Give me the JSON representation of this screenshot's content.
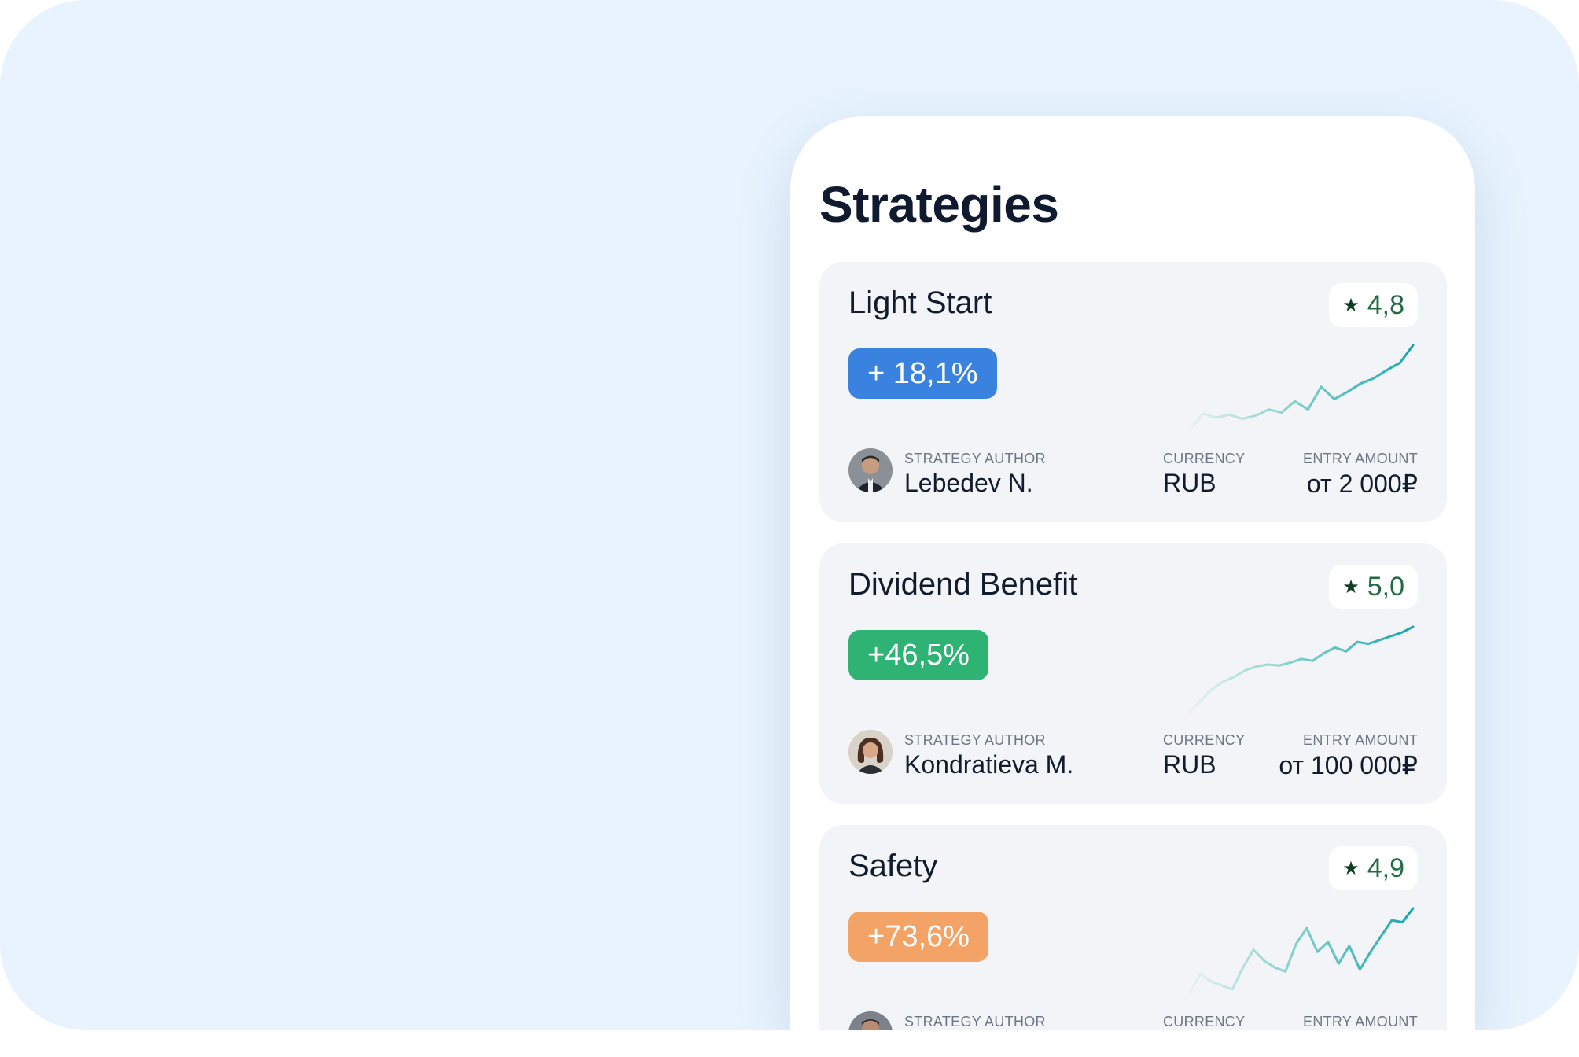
{
  "screen": {
    "title": "Strategies"
  },
  "labels": {
    "author": "STRATEGY AUTHOR",
    "currency": "CURRENCY",
    "entry": "ENTRY AMOUNT"
  },
  "strategies": [
    {
      "name": "Light Start",
      "rating": "4,8",
      "return": "+ 18,1%",
      "return_color": "#3a82e0",
      "author": "Lebedev N.",
      "currency": "RUB",
      "entry_amount": "от 2 000₽",
      "trend": [
        10,
        26,
        22,
        25,
        21,
        24,
        30,
        27,
        38,
        30,
        52,
        40,
        47,
        55,
        60,
        68,
        75,
        92
      ]
    },
    {
      "name": "Dividend Benefit",
      "rating": "5,0",
      "return": "+46,5%",
      "return_color": "#2fb374",
      "author": "Kondratieva M.",
      "currency": "RUB",
      "entry_amount": "от 100 000₽",
      "trend": [
        8,
        20,
        32,
        40,
        45,
        52,
        56,
        58,
        57,
        60,
        64,
        62,
        70,
        76,
        72,
        82,
        80,
        84,
        88,
        92,
        98
      ]
    },
    {
      "name": "Safety",
      "rating": "4,9",
      "return": "+73,6%",
      "return_color": "#f3a365",
      "author": "",
      "currency": "",
      "entry_amount": "",
      "trend": [
        22,
        42,
        34,
        30,
        26,
        48,
        66,
        55,
        48,
        44,
        72,
        88,
        64,
        74,
        52,
        70,
        46,
        64,
        80,
        96,
        94,
        108
      ]
    }
  ]
}
